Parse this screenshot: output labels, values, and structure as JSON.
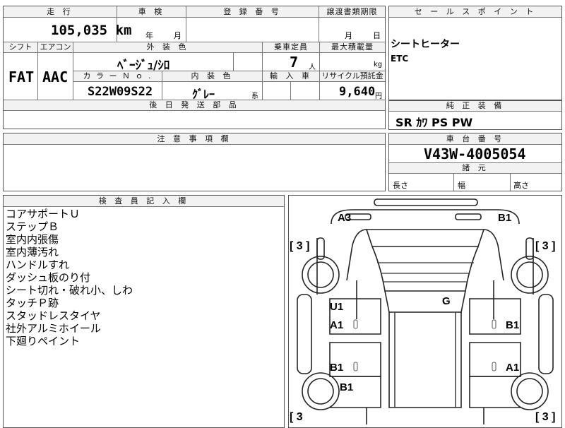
{
  "top": {
    "h_mileage": "走 行",
    "mileage": "105,035 km",
    "h_inspection": "車 検",
    "inspection_year": "年",
    "inspection_month": "月",
    "h_registration": "登 録 番 号",
    "h_transfer": "譲渡書類期限",
    "transfer_month": "月",
    "transfer_day": "日",
    "h_shift": "シフト",
    "shift": "FAT",
    "h_ac": "エアコン",
    "ac": "AAC",
    "h_exterior": "外 装 色",
    "exterior": "ﾍﾞｰｼﾞｭ/ｼﾛ",
    "h_capacity": "乗車定員",
    "capacity": "7",
    "capacity_unit": "人",
    "h_load": "最大積載量",
    "load_unit": "kg",
    "h_color_no": "カ ラ ー Ｎ ｏ .",
    "color_no": "S22W09S22",
    "h_interior": "内 装 色",
    "interior": "ｸﾞﾚｰ",
    "interior_suffix": "系",
    "h_import": "輸 入 車",
    "h_recycle": "リサイクル預託金",
    "recycle": "9,640",
    "recycle_unit": "円",
    "h_later": "後 日 発 送 部 品"
  },
  "sales": {
    "header": "セ ー ル ス ポ イ ン ト",
    "lines": [
      "シートヒーター",
      "ETC"
    ]
  },
  "equipment": {
    "header": "純 正 装 備",
    "value": "SR ｶﾜ PS PW"
  },
  "caution": {
    "header": "注 意 事 項 欄"
  },
  "chassis": {
    "header": "車 台 番 号",
    "number": "V43W-4005054",
    "dims_header": "諸 元",
    "length": "長さ",
    "width": "幅",
    "height": "高さ"
  },
  "inspector": {
    "header": "検 査 員 記 入 欄",
    "notes": [
      "コアサポートＵ",
      "ステップＢ",
      "室内内張傷",
      "室内薄汚れ",
      "ハンドルすれ",
      "ダッシュ板のり付",
      "シート切れ・破れ小、しわ",
      "タッチＰ跡",
      "スタッドレスタイヤ",
      "社外アルミホイール",
      "下廻りペイント"
    ]
  },
  "diagram": {
    "marks": {
      "a3": "A3",
      "b1_top": "B1",
      "u1": "U1",
      "g": "G",
      "a1_left": "A1",
      "b1_right": "B1",
      "b1_left": "B1",
      "a1_right": "A1",
      "b1_bottom": "B1"
    },
    "brackets": {
      "tl": "[ 3 ]",
      "tr": "[ 3 ]",
      "bl": "[ 3",
      "br": "[ 3 ]"
    }
  }
}
